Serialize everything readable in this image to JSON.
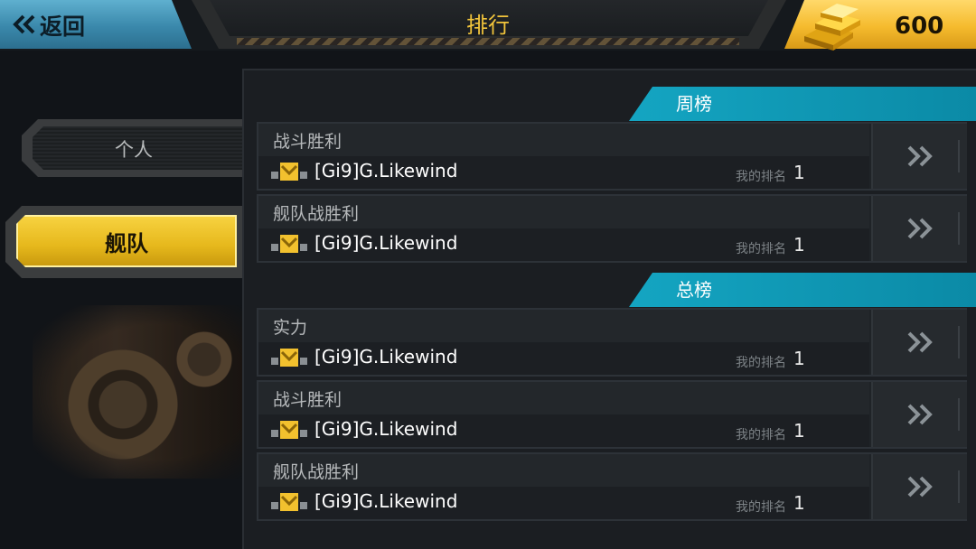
{
  "header": {
    "back_label": "返回",
    "title": "排行",
    "currency_value": "600"
  },
  "tabs": [
    {
      "label": "个人",
      "selected": false
    },
    {
      "label": "舰队",
      "selected": true
    }
  ],
  "sections": {
    "weekly": {
      "title": "周榜"
    },
    "total": {
      "title": "总榜"
    }
  },
  "rows": [
    {
      "title": "战斗胜利",
      "player": "[Gi9]G.Likewind",
      "my_rank_label": "我的排名",
      "my_rank": "1"
    },
    {
      "title": "舰队战胜利",
      "player": "[Gi9]G.Likewind",
      "my_rank_label": "我的排名",
      "my_rank": "1"
    },
    {
      "title": "实力",
      "player": "[Gi9]G.Likewind",
      "my_rank_label": "我的排名",
      "my_rank": "1"
    },
    {
      "title": "战斗胜利",
      "player": "[Gi9]G.Likewind",
      "my_rank_label": "我的排名",
      "my_rank": "1"
    },
    {
      "title": "舰队战胜利",
      "player": "[Gi9]G.Likewind",
      "my_rank_label": "我的排名",
      "my_rank": "1"
    }
  ],
  "icons": {
    "back": "double-chevron-left-icon",
    "currency": "gold-bars-icon",
    "rank": "rank-insignia-icon",
    "row_arrow": "double-chevron-right-icon"
  },
  "colors": {
    "accent_gold": "#f2c53b",
    "section_cyan": "#14a5c2",
    "back_blue": "#3a88ab"
  }
}
